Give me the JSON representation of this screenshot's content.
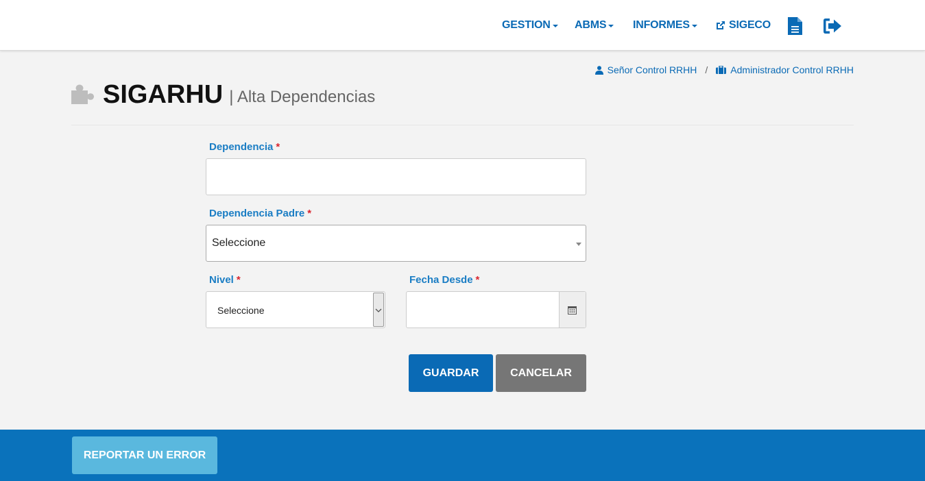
{
  "nav": {
    "gestion": "GESTION",
    "abms": "ABMS",
    "informes": "INFORMES",
    "sigeco": "SIGECO",
    "icons": [
      "external-link-icon",
      "document-icon",
      "sign-out-icon"
    ]
  },
  "user": {
    "name": "Señor Control RRHH",
    "separator": "/",
    "role": "Administrador Control RRHH"
  },
  "header": {
    "title": "SIGARHU",
    "subtitle": "| Alta Dependencias"
  },
  "form": {
    "dependencia": {
      "label": "Dependencia",
      "required": "*",
      "value": ""
    },
    "dependencia_padre": {
      "label": "Dependencia Padre",
      "required": "*",
      "value": "Seleccione"
    },
    "nivel": {
      "label": "Nivel",
      "required": "*",
      "value": "Seleccione"
    },
    "fecha_desde": {
      "label": "Fecha Desde",
      "required": "*",
      "value": ""
    },
    "save_label": "GUARDAR",
    "cancel_label": "CANCELAR"
  },
  "footer": {
    "report_label": "REPORTAR UN ERROR"
  },
  "colors": {
    "brand_blue": "#0a6ab5",
    "label_blue": "#1a7dc4",
    "required_red": "#d9252e",
    "save_button": "#0a6ab5",
    "cancel_button": "#767676",
    "footer": "#0a72bb",
    "report_button": "#5ab8de"
  }
}
